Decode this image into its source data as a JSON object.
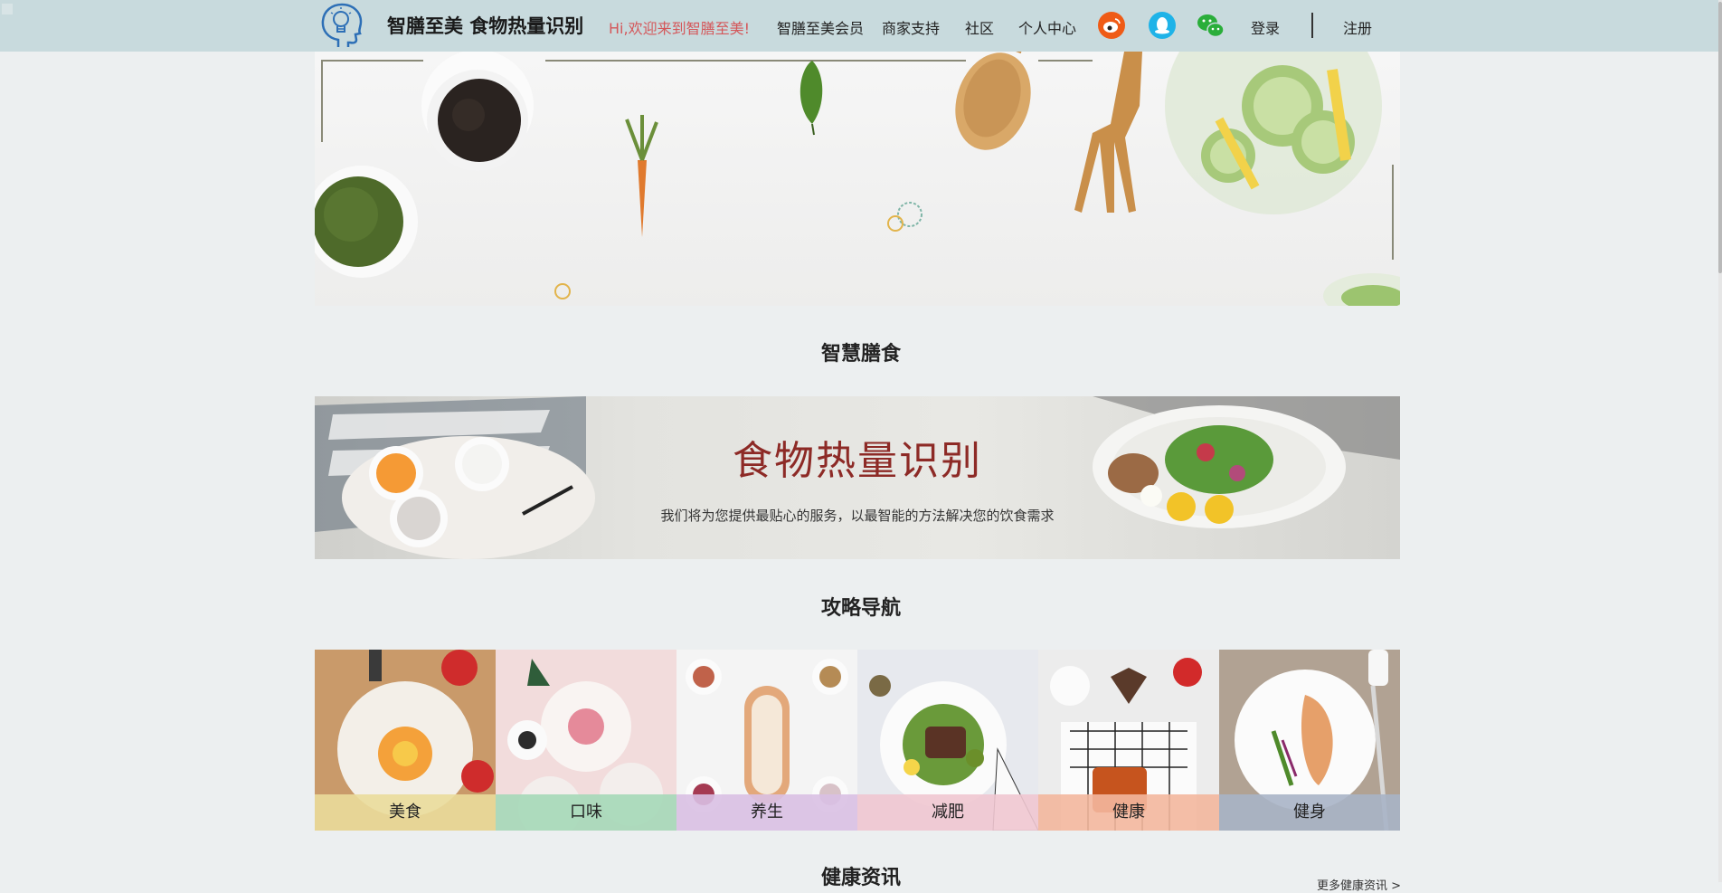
{
  "header": {
    "logo_icon": "head-lightbulb-icon",
    "title": "智膳至美 食物热量识别",
    "welcome": "Hi,欢迎来到智膳至美!",
    "nav": [
      "智膳至美会员",
      "商家支持",
      "社区",
      "个人中心"
    ],
    "social_icons": [
      "weibo-icon",
      "qq-icon",
      "wechat-icon"
    ],
    "login": "登录",
    "register": "注册"
  },
  "sections": {
    "smart_diet": "智慧膳食",
    "guide_nav": "攻略导航",
    "health_news": "健康资讯"
  },
  "feature_banner": {
    "title": "食物热量识别",
    "subtitle": "我们将为您提供最贴心的服务，以最智能的方法解决您的饮食需求"
  },
  "guide_tiles": [
    {
      "label": "美食",
      "color": "#eadc9b"
    },
    {
      "label": "口味",
      "color": "#a5d8b8"
    },
    {
      "label": "养生",
      "color": "#d9c0e3"
    },
    {
      "label": "减肥",
      "color": "#f0c7d0"
    },
    {
      "label": "健康",
      "color": "#f3b79d"
    },
    {
      "label": "健身",
      "color": "#a9b4c6"
    }
  ],
  "more_link": "更多健康资讯 >",
  "colors": {
    "topbar": "#c8dadd",
    "accent_red": "#8d2a26",
    "welcome": "#d4575a"
  }
}
